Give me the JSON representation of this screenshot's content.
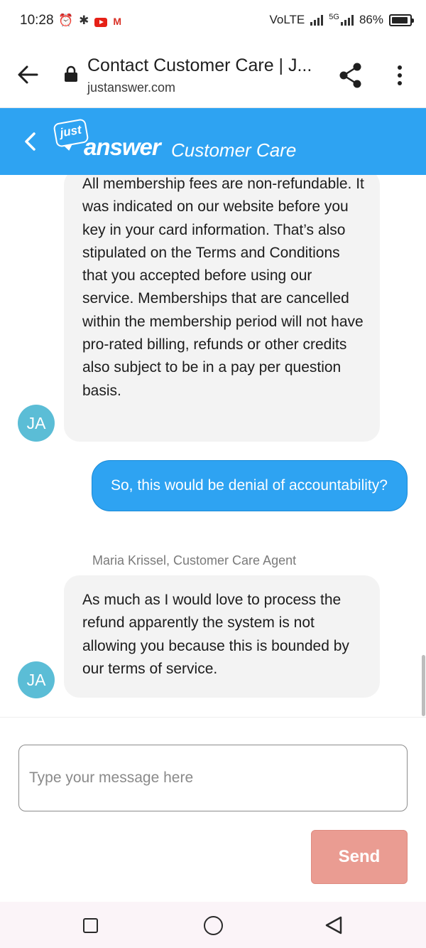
{
  "status_bar": {
    "time": "10:28",
    "network": "VoLTE",
    "network_sub": "5G",
    "battery": "86%"
  },
  "browser": {
    "page_title": "Contact Customer Care | J...",
    "url": "justanswer.com"
  },
  "app_header": {
    "logo_small": "just",
    "logo_main": "answer",
    "subtitle": "Customer Care"
  },
  "messages": [
    {
      "sender": "agent",
      "avatar": "JA",
      "text": "All membership fees are non-refundable. It was indicated on our website before you key in your card information. That’s also stipulated on the Terms and Conditions that you accepted before using our service. Memberships that are cancelled within the membership period will not have pro-rated billing, refunds or other credits also subject to be in a pay per question basis."
    },
    {
      "sender": "user",
      "text": "So, this would be denial of accountability?"
    },
    {
      "sender": "agent",
      "name": "Maria Krissel, Customer Care Agent",
      "avatar": "JA",
      "text": "As much as I would love to process the refund apparently the system is not allowing you because this is bounded by our terms of service."
    }
  ],
  "composer": {
    "placeholder": "Type your message here",
    "value": "",
    "send_label": "Send"
  },
  "colors": {
    "brand_blue": "#2ea3f2",
    "agent_bubble": "#f3f3f3",
    "avatar": "#5bbdd6",
    "send_disabled": "#ea9c92"
  }
}
